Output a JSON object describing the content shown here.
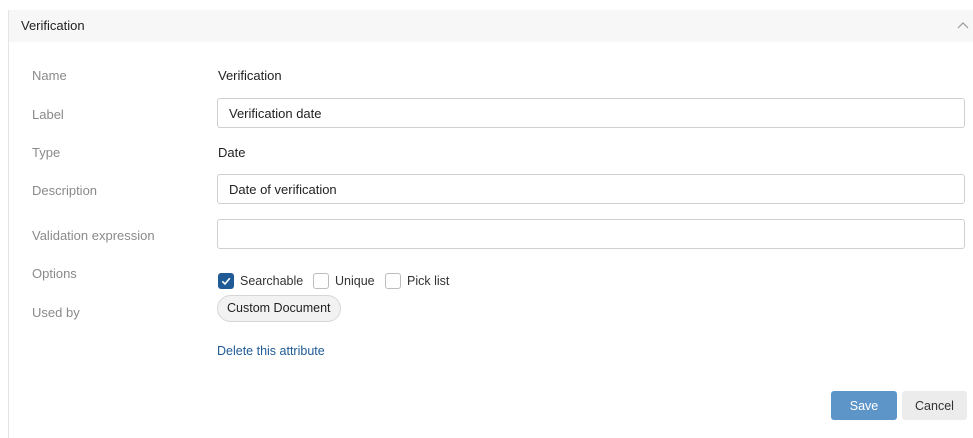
{
  "section": {
    "title": "Verification"
  },
  "rows": {
    "name": {
      "label": "Name",
      "value": "Verification"
    },
    "label": {
      "label": "Label",
      "value": "Verification date"
    },
    "type": {
      "label": "Type",
      "value": "Date"
    },
    "description": {
      "label": "Description",
      "value": "Date of verification"
    },
    "validation": {
      "label": "Validation expression",
      "value": ""
    },
    "options": {
      "label": "Options"
    },
    "used_by": {
      "label": "Used by",
      "chip": "Custom Document"
    }
  },
  "options": [
    {
      "label": "Searchable",
      "checked": true
    },
    {
      "label": "Unique",
      "checked": false
    },
    {
      "label": "Pick list",
      "checked": false
    }
  ],
  "delete_link": "Delete this attribute",
  "actions": {
    "save": "Save",
    "cancel": "Cancel"
  },
  "colors": {
    "accent": "#1f5a96",
    "save_button": "#5e95c9"
  }
}
